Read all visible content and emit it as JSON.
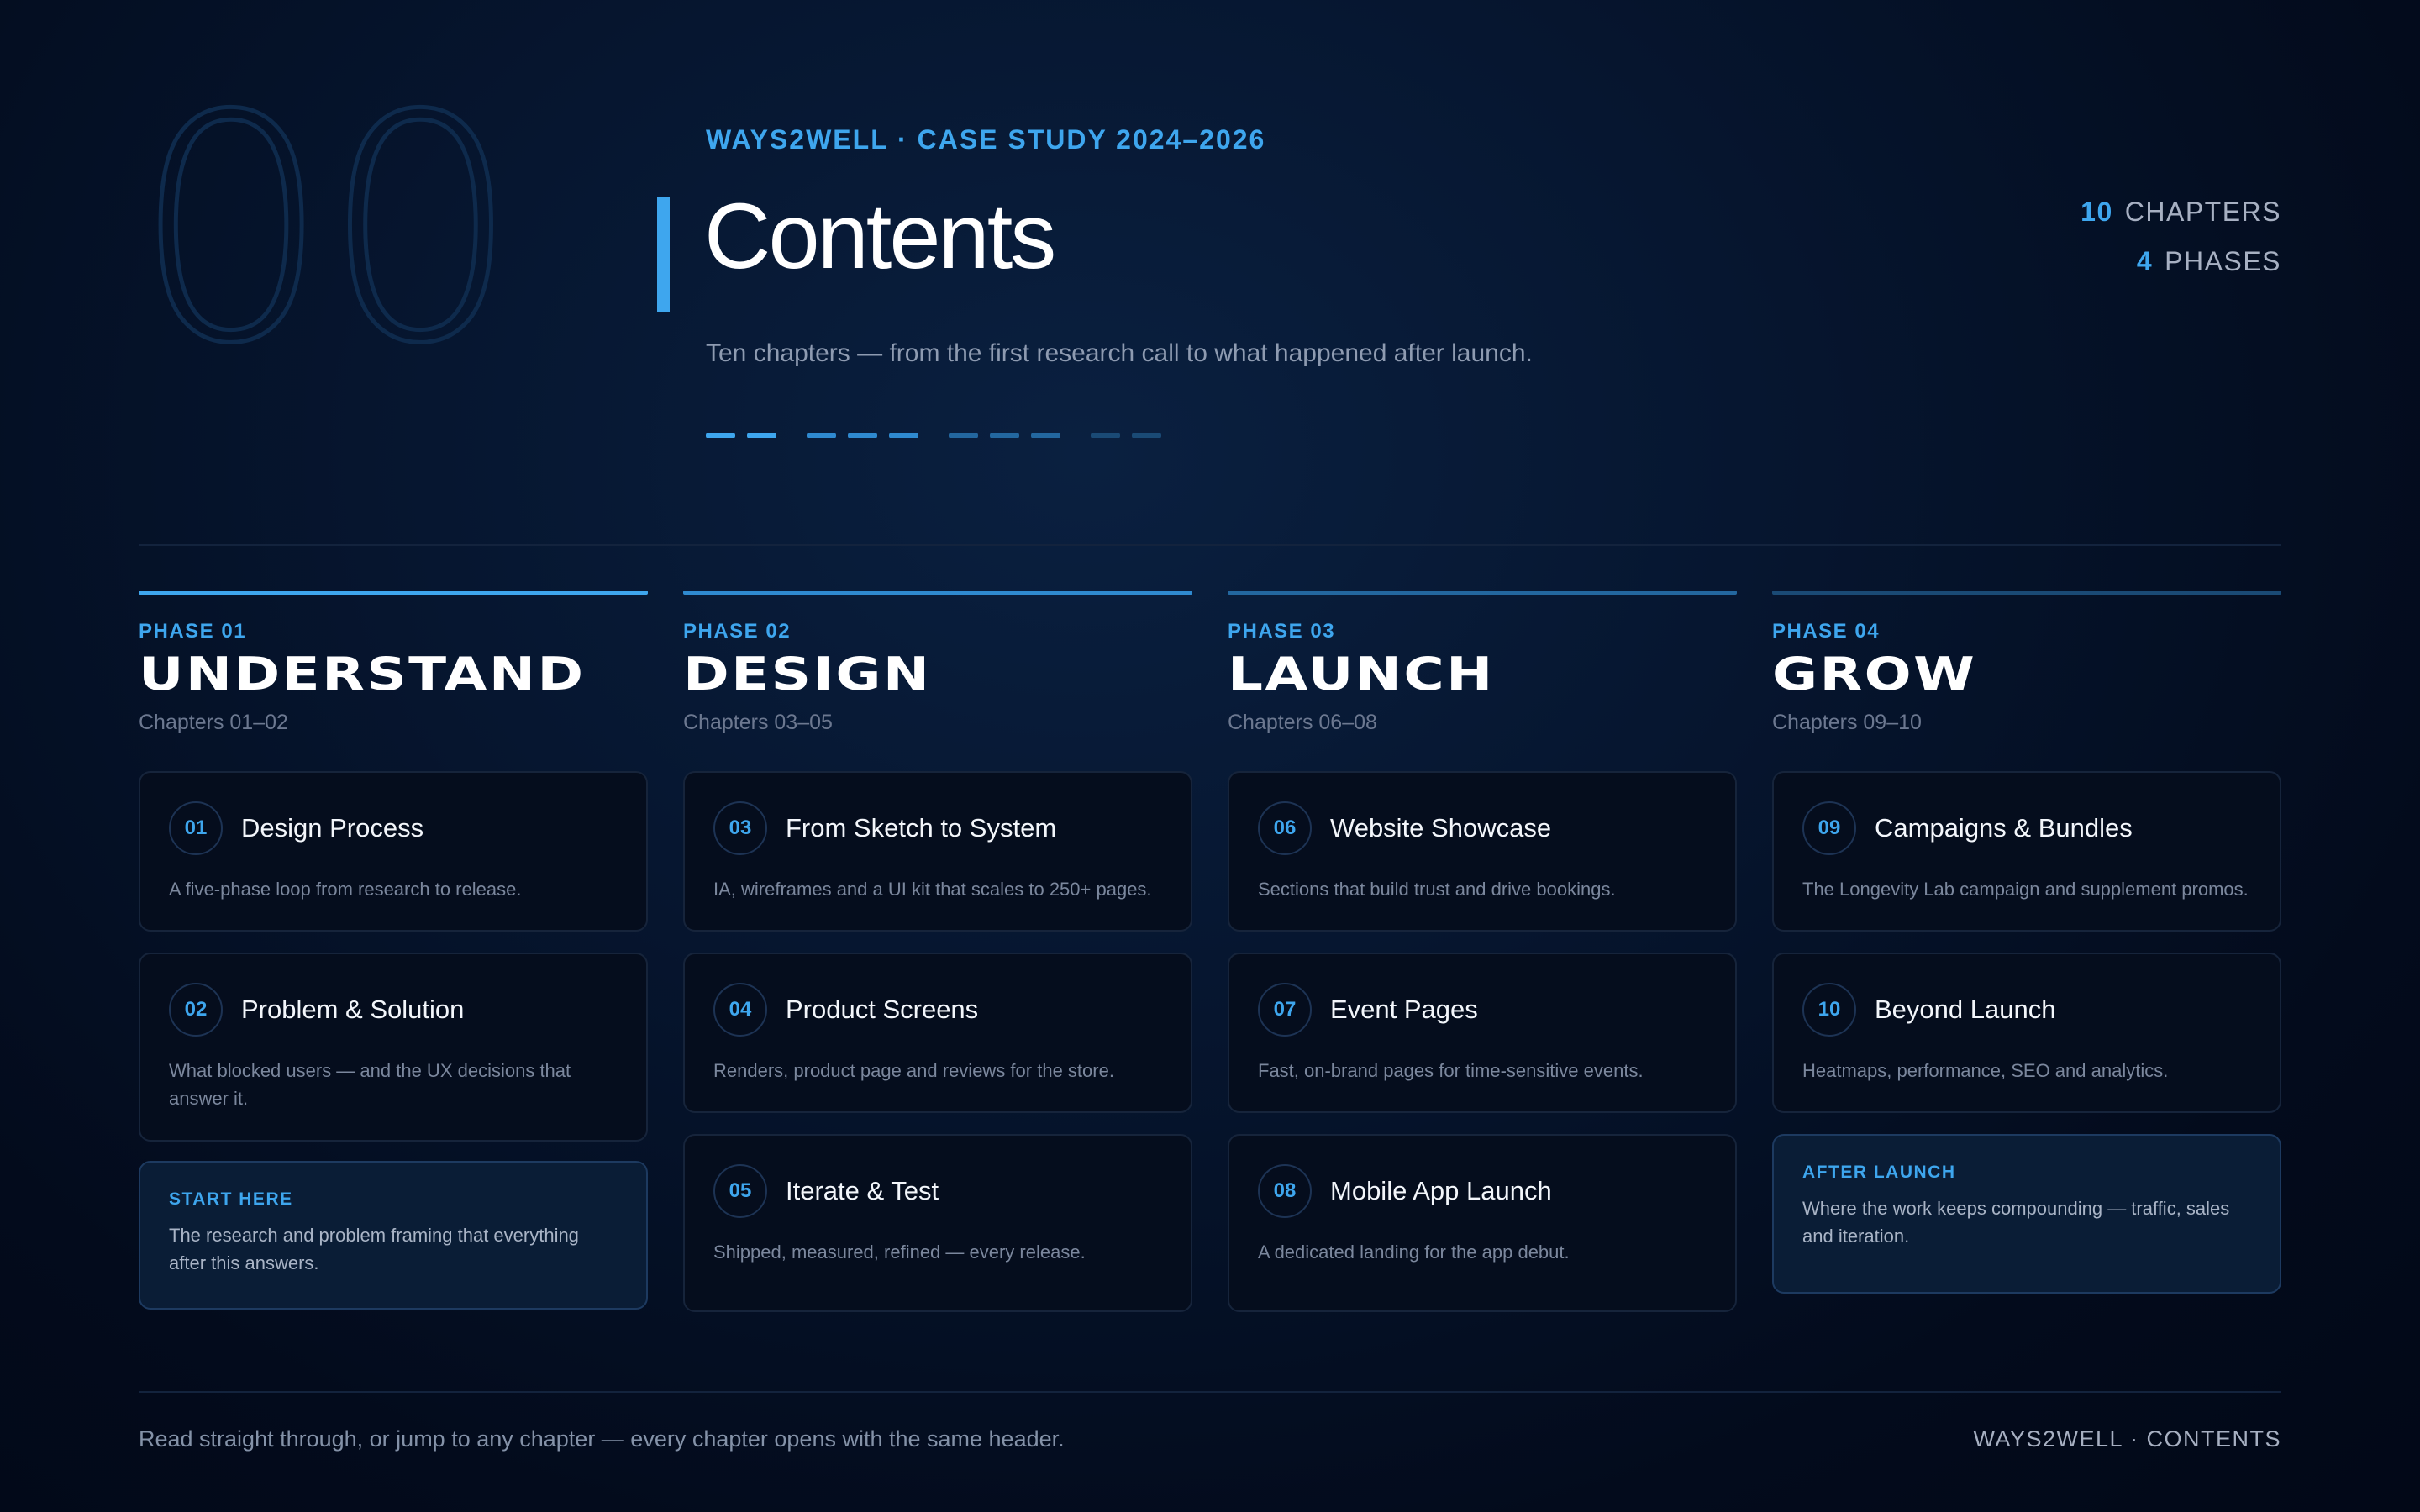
{
  "header": {
    "big_number": "00",
    "eyebrow": "WAYS2WELL · CASE STUDY 2024–2026",
    "title": "Contents",
    "subtitle": "Ten chapters — from the first research call to what happened after launch.",
    "stats": [
      {
        "num": "10",
        "label": "CHAPTERS"
      },
      {
        "num": "4",
        "label": "PHASES"
      }
    ]
  },
  "colors": {
    "accent": "#3ea6ee",
    "background": "#030b1c",
    "card_bg": "#050d1d",
    "note_bg": "#0a1d36"
  },
  "phases": [
    {
      "label": "PHASE 01",
      "name": "UNDERSTAND",
      "chapters": "Chapters 01–02",
      "cards": [
        {
          "num": "01",
          "title": "Design Process",
          "desc": "A five-phase loop from research to release."
        },
        {
          "num": "02",
          "title": "Problem & Solution",
          "desc": "What blocked users — and the UX decisions that answer it."
        }
      ],
      "note": {
        "label": "START HERE",
        "text": "The research and problem framing that everything after this answers."
      }
    },
    {
      "label": "PHASE 02",
      "name": "DESIGN",
      "chapters": "Chapters 03–05",
      "cards": [
        {
          "num": "03",
          "title": "From Sketch to System",
          "desc": "IA, wireframes and a UI kit that scales to 250+ pages."
        },
        {
          "num": "04",
          "title": "Product Screens",
          "desc": "Renders, product page and reviews for the store."
        },
        {
          "num": "05",
          "title": "Iterate & Test",
          "desc": "Shipped, measured, refined — every release."
        }
      ]
    },
    {
      "label": "PHASE 03",
      "name": "LAUNCH",
      "chapters": "Chapters 06–08",
      "cards": [
        {
          "num": "06",
          "title": "Website Showcase",
          "desc": "Sections that build trust and drive bookings."
        },
        {
          "num": "07",
          "title": "Event Pages",
          "desc": "Fast, on-brand pages for time-sensitive events."
        },
        {
          "num": "08",
          "title": "Mobile App Launch",
          "desc": "A dedicated landing for the app debut."
        }
      ]
    },
    {
      "label": "PHASE 04",
      "name": "GROW",
      "chapters": "Chapters 09–10",
      "cards": [
        {
          "num": "09",
          "title": "Campaigns & Bundles",
          "desc": "The Longevity Lab campaign and supplement promos."
        },
        {
          "num": "10",
          "title": "Beyond Launch",
          "desc": "Heatmaps, performance, SEO and analytics."
        }
      ],
      "note": {
        "label": "AFTER LAUNCH",
        "text": "Where the work keeps compounding — traffic, sales and iteration."
      }
    }
  ],
  "footer": {
    "text": "Read straight through, or jump to any chapter — every chapter opens with the same header.",
    "right": "WAYS2WELL · CONTENTS"
  }
}
